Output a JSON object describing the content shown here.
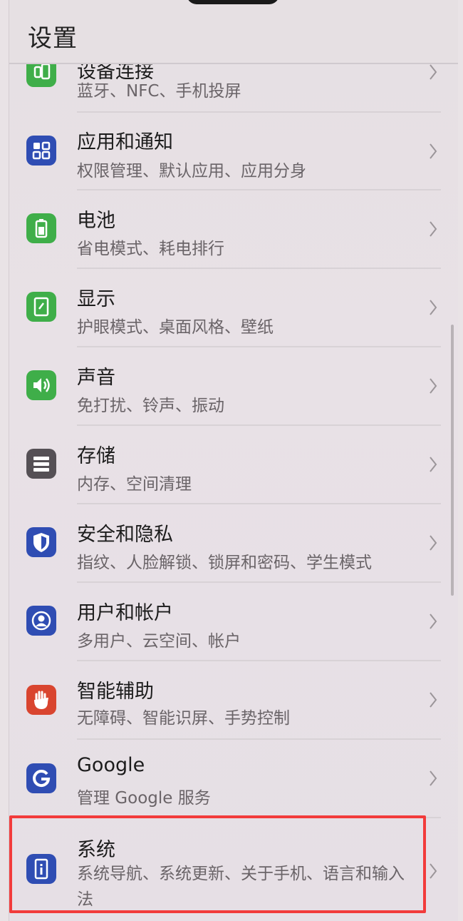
{
  "header": {
    "title": "设置"
  },
  "items": [
    {
      "label": "设备连接",
      "subtitle": "蓝牙、NFC、手机投屏",
      "icon": "device-connection-icon",
      "color": "#3fae49"
    },
    {
      "label": "应用和通知",
      "subtitle": "权限管理、默认应用、应用分身",
      "icon": "apps-grid-icon",
      "color": "#2f4db3"
    },
    {
      "label": "电池",
      "subtitle": "省电模式、耗电排行",
      "icon": "battery-icon",
      "color": "#3fae49"
    },
    {
      "label": "显示",
      "subtitle": "护眼模式、桌面风格、壁纸",
      "icon": "display-icon",
      "color": "#3fae49"
    },
    {
      "label": "声音",
      "subtitle": "免打扰、铃声、振动",
      "icon": "speaker-icon",
      "color": "#3fae49"
    },
    {
      "label": "存储",
      "subtitle": "内存、空间清理",
      "icon": "storage-icon",
      "color": "#555055"
    },
    {
      "label": "安全和隐私",
      "subtitle": "指纹、人脸解锁、锁屏和密码、学生模式",
      "icon": "shield-icon",
      "color": "#2f4db3"
    },
    {
      "label": "用户和帐户",
      "subtitle": "多用户、云空间、帐户",
      "icon": "user-icon",
      "color": "#2f4db3"
    },
    {
      "label": "智能辅助",
      "subtitle": "无障碍、智能识屏、手势控制",
      "icon": "hand-icon",
      "color": "#d9452f"
    },
    {
      "label": "Google",
      "subtitle": "管理 Google 服务",
      "icon": "google-icon",
      "color": "#2f4db3"
    },
    {
      "label": "系统",
      "subtitle": "系统导航、系统更新、关于手机、语言和输入法",
      "icon": "system-info-icon",
      "color": "#2f4db3"
    }
  ]
}
